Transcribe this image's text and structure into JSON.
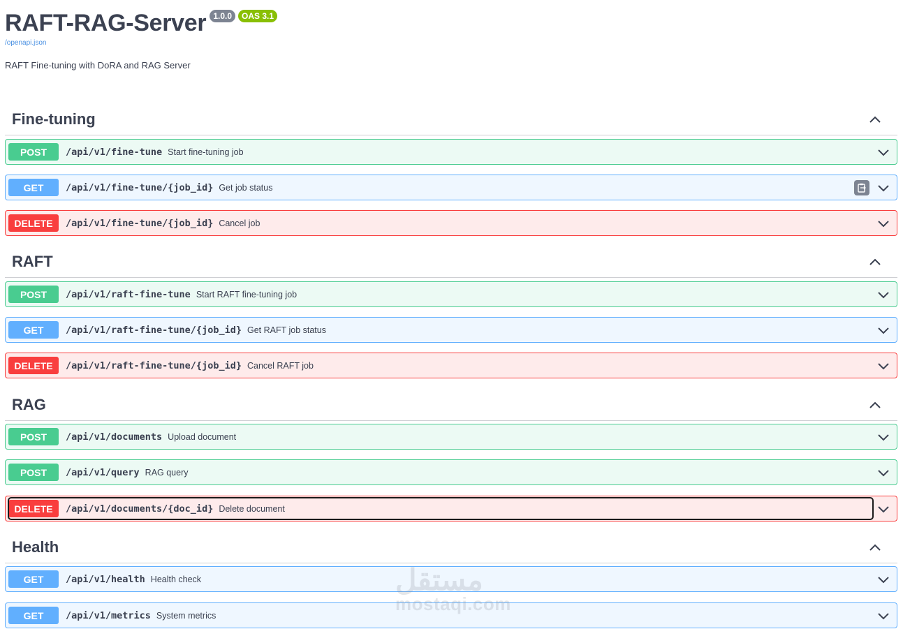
{
  "info": {
    "title": "RAFT-RAG-Server",
    "version": "1.0.0",
    "oas": "OAS 3.1",
    "spec_link": "/openapi.json",
    "description": "RAFT Fine-tuning with DoRA and RAG Server"
  },
  "colors": {
    "post": "#49cc90",
    "get": "#61affe",
    "delete": "#f93e3e"
  },
  "sections": [
    {
      "name": "Fine-tuning",
      "ops": [
        {
          "method": "POST",
          "path": "/api/v1/fine-tune",
          "summary": "Start fine-tuning job"
        },
        {
          "method": "GET",
          "path": "/api/v1/fine-tune/{job_id}",
          "summary": "Get job status"
        },
        {
          "method": "DELETE",
          "path": "/api/v1/fine-tune/{job_id}",
          "summary": "Cancel job"
        }
      ]
    },
    {
      "name": "RAFT",
      "ops": [
        {
          "method": "POST",
          "path": "/api/v1/raft-fine-tune",
          "summary": "Start RAFT fine-tuning job"
        },
        {
          "method": "GET",
          "path": "/api/v1/raft-fine-tune/{job_id}",
          "summary": "Get RAFT job status"
        },
        {
          "method": "DELETE",
          "path": "/api/v1/raft-fine-tune/{job_id}",
          "summary": "Cancel RAFT job"
        }
      ]
    },
    {
      "name": "RAG",
      "ops": [
        {
          "method": "POST",
          "path": "/api/v1/documents",
          "summary": "Upload document"
        },
        {
          "method": "POST",
          "path": "/api/v1/query",
          "summary": "RAG query"
        },
        {
          "method": "DELETE",
          "path": "/api/v1/documents/{doc_id}",
          "summary": "Delete document"
        }
      ]
    },
    {
      "name": "Health",
      "ops": [
        {
          "method": "GET",
          "path": "/api/v1/health",
          "summary": "Health check"
        },
        {
          "method": "GET",
          "path": "/api/v1/metrics",
          "summary": "System metrics"
        }
      ]
    }
  ],
  "watermark": {
    "arabic": "مستقل",
    "latin": "mostaqi.com"
  }
}
